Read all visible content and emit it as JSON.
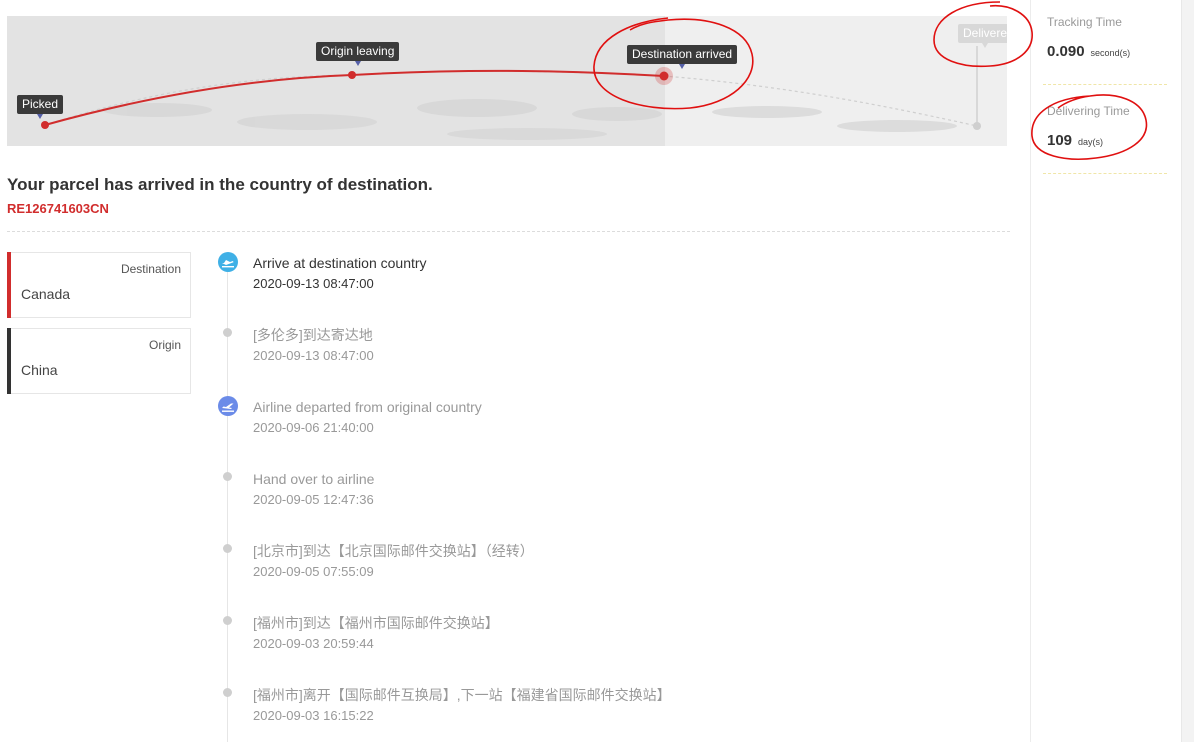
{
  "route": {
    "pins": [
      {
        "label": "Picked",
        "state": "done"
      },
      {
        "label": "Origin leaving",
        "state": "done"
      },
      {
        "label": "Destination arrived",
        "state": "current"
      },
      {
        "label": "Delivere",
        "state": "pending"
      }
    ],
    "colors": {
      "route": "#d12d2d",
      "pending": "#d8d8d8"
    }
  },
  "summary": {
    "headline": "Your parcel has arrived in the country of destination.",
    "tracking_number": "RE126741603CN"
  },
  "cards": [
    {
      "kind": "Destination",
      "country": "Canada",
      "accent": "#d12d2d"
    },
    {
      "kind": "Origin",
      "country": "China",
      "accent": "#333333"
    }
  ],
  "events": [
    {
      "title": "Arrive at destination country",
      "time": "2020-09-13 08:47:00",
      "icon": "plane-arrival-icon",
      "status": "current"
    },
    {
      "title": "[多伦多]到达寄达地",
      "time": "2020-09-13 08:47:00",
      "icon": "dot",
      "status": "past"
    },
    {
      "title": "Airline departed from original country",
      "time": "2020-09-06 21:40:00",
      "icon": "plane-departure-icon",
      "status": "past"
    },
    {
      "title": "Hand over to airline",
      "time": "2020-09-05 12:47:36",
      "icon": "dot",
      "status": "past"
    },
    {
      "title": "[北京市]到达【北京国际邮件交换站】（经转）",
      "time": "2020-09-05 07:55:09",
      "icon": "dot",
      "status": "past"
    },
    {
      "title": "[福州市]到达【福州市国际邮件交换站】",
      "time": "2020-09-03 20:59:44",
      "icon": "dot",
      "status": "past"
    },
    {
      "title": "[福州市]离开【国际邮件互换局】,下一站【福建省国际邮件交换站】",
      "time": "2020-09-03 16:15:22",
      "icon": "dot",
      "status": "past"
    }
  ],
  "stats": {
    "tracking_time": {
      "label": "Tracking Time",
      "value": "0.090",
      "unit": "second(s)"
    },
    "delivering_time": {
      "label": "Delivering Time",
      "value": "109",
      "unit": "day(s)"
    }
  }
}
